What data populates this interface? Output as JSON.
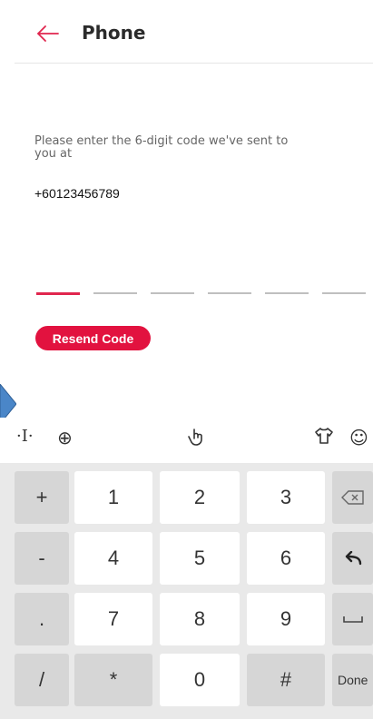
{
  "header": {
    "title": "Phone",
    "back_icon": "arrow-left-icon",
    "accent": "#e0264e"
  },
  "verification": {
    "instruction_line1": "Please enter the 6-digit code we've sent to",
    "instruction_line2": "you at",
    "phone_number": "+60123456789",
    "code_length": 6,
    "active_index": 0
  },
  "resend": {
    "label": "Resend Code",
    "color": "#e2123f"
  },
  "keyboard_toolbar": {
    "icons": [
      "cursor-icon",
      "globe-icon",
      "gesture-icon",
      "shirt-icon",
      "emoji-icon"
    ]
  },
  "keypad": {
    "rows": [
      [
        "+",
        "1",
        "2",
        "3",
        "⌫"
      ],
      [
        "-",
        "4",
        "5",
        "6",
        "↵"
      ],
      [
        ".",
        "7",
        "8",
        "9",
        "␣"
      ],
      [
        "/",
        "*",
        "0",
        "#",
        "Done"
      ]
    ]
  }
}
